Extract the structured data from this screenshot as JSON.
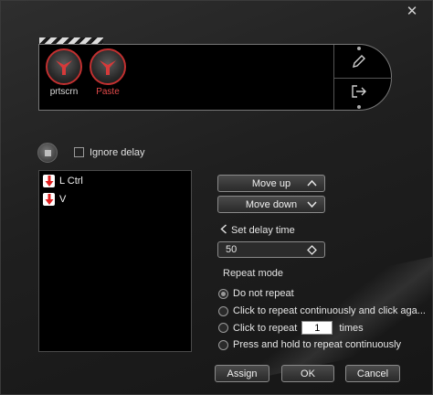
{
  "window": {
    "close_glyph": "✕"
  },
  "macro": {
    "tiles": [
      {
        "label": "prtscrn",
        "icon": "legion-logo-icon"
      },
      {
        "label": "Paste",
        "icon": "legion-logo-icon"
      }
    ],
    "side_icons": [
      "edit-pencil-icon",
      "export-icon"
    ]
  },
  "record": {
    "ignore_delay_label": "Ignore delay",
    "ignore_delay_checked": false
  },
  "key_list": {
    "items": [
      {
        "icon": "key-down-arrow-icon",
        "label": "L Ctrl"
      },
      {
        "icon": "key-down-arrow-icon",
        "label": "V"
      }
    ]
  },
  "actions": {
    "move_up": "Move up",
    "move_down": "Move down"
  },
  "delay": {
    "label": "Set delay time",
    "value": "50"
  },
  "repeat": {
    "title": "Repeat mode",
    "options": [
      {
        "label": "Do not repeat",
        "selected": true
      },
      {
        "label": "Click to repeat continuously and click aga...",
        "selected": false
      },
      {
        "label_before": "Click to repeat",
        "value": "1",
        "label_after": "times",
        "selected": false
      },
      {
        "label": "Press and hold to repeat continuously",
        "selected": false
      }
    ]
  },
  "footer": {
    "assign": "Assign",
    "ok": "OK",
    "cancel": "Cancel"
  },
  "colors": {
    "accent_red": "#c23030",
    "paste_label": "#e24a4a",
    "background": "#1f1f1f"
  }
}
